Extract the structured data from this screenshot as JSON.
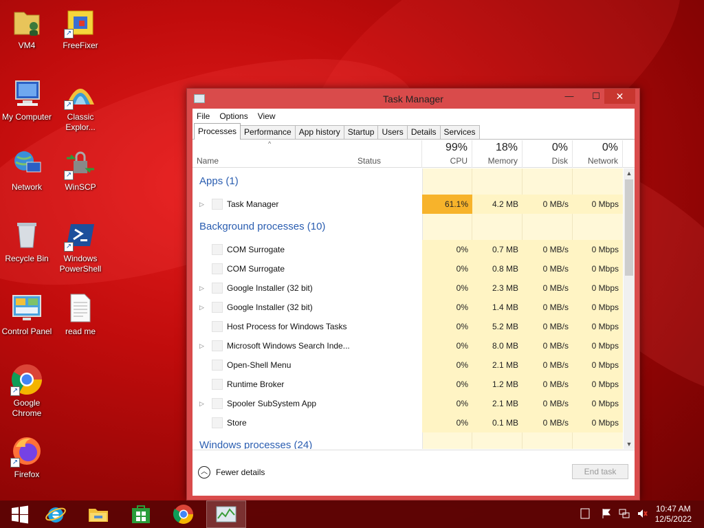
{
  "desktop": {
    "icons": [
      {
        "label": "VM4",
        "icon": "folder-user-icon"
      },
      {
        "label": "FreeFixer",
        "icon": "freefixer-icon"
      },
      {
        "label": "My Computer",
        "icon": "computer-icon"
      },
      {
        "label": "Classic Explor...",
        "icon": "classic-explorer-icon"
      },
      {
        "label": "Network",
        "icon": "network-icon"
      },
      {
        "label": "WinSCP",
        "icon": "winscp-icon"
      },
      {
        "label": "Recycle Bin",
        "icon": "recycle-bin-icon"
      },
      {
        "label": "Windows PowerShell",
        "icon": "powershell-icon"
      },
      {
        "label": "Control Panel",
        "icon": "control-panel-icon"
      },
      {
        "label": "read me",
        "icon": "text-file-icon"
      },
      {
        "label": "Google Chrome",
        "icon": "chrome-icon"
      },
      {
        "label": "Firefox",
        "icon": "firefox-icon"
      }
    ]
  },
  "window": {
    "title": "Task Manager",
    "menu": [
      "File",
      "Options",
      "View"
    ],
    "tabs": [
      "Processes",
      "Performance",
      "App history",
      "Startup",
      "Users",
      "Details",
      "Services"
    ],
    "active_tab": "Processes",
    "columns": {
      "name": "Name",
      "status": "Status",
      "cpu": {
        "pct": "99%",
        "label": "CPU"
      },
      "memory": {
        "pct": "18%",
        "label": "Memory"
      },
      "disk": {
        "pct": "0%",
        "label": "Disk"
      },
      "network": {
        "pct": "0%",
        "label": "Network"
      }
    },
    "groups": {
      "apps": "Apps (1)",
      "background": "Background processes (10)",
      "windows": "Windows processes (24)"
    },
    "apps": [
      {
        "name": "Task Manager",
        "cpu": "61.1%",
        "memory": "4.2 MB",
        "disk": "0 MB/s",
        "network": "0 Mbps",
        "expandable": true
      }
    ],
    "background": [
      {
        "name": "COM Surrogate",
        "cpu": "0%",
        "memory": "0.7 MB",
        "disk": "0 MB/s",
        "network": "0 Mbps",
        "expandable": false
      },
      {
        "name": "COM Surrogate",
        "cpu": "0%",
        "memory": "0.8 MB",
        "disk": "0 MB/s",
        "network": "0 Mbps",
        "expandable": false
      },
      {
        "name": "Google Installer (32 bit)",
        "cpu": "0%",
        "memory": "2.3 MB",
        "disk": "0 MB/s",
        "network": "0 Mbps",
        "expandable": true
      },
      {
        "name": "Google Installer (32 bit)",
        "cpu": "0%",
        "memory": "1.4 MB",
        "disk": "0 MB/s",
        "network": "0 Mbps",
        "expandable": true
      },
      {
        "name": "Host Process for Windows Tasks",
        "cpu": "0%",
        "memory": "5.2 MB",
        "disk": "0 MB/s",
        "network": "0 Mbps",
        "expandable": false
      },
      {
        "name": "Microsoft Windows Search Inde...",
        "cpu": "0%",
        "memory": "8.0 MB",
        "disk": "0 MB/s",
        "network": "0 Mbps",
        "expandable": true
      },
      {
        "name": "Open-Shell Menu",
        "cpu": "0%",
        "memory": "2.1 MB",
        "disk": "0 MB/s",
        "network": "0 Mbps",
        "expandable": false
      },
      {
        "name": "Runtime Broker",
        "cpu": "0%",
        "memory": "1.2 MB",
        "disk": "0 MB/s",
        "network": "0 Mbps",
        "expandable": false
      },
      {
        "name": "Spooler SubSystem App",
        "cpu": "0%",
        "memory": "2.1 MB",
        "disk": "0 MB/s",
        "network": "0 Mbps",
        "expandable": true
      },
      {
        "name": "Store",
        "cpu": "0%",
        "memory": "0.1 MB",
        "disk": "0 MB/s",
        "network": "0 Mbps",
        "expandable": false
      }
    ],
    "footer": {
      "fewer_details": "Fewer details",
      "end_task": "End task"
    }
  },
  "taskbar": {
    "pinned": [
      "start-icon",
      "internet-explorer-icon",
      "file-explorer-icon",
      "store-icon",
      "chrome-icon",
      "task-manager-icon"
    ],
    "time": "10:47 AM",
    "date": "12/5/2022"
  }
}
